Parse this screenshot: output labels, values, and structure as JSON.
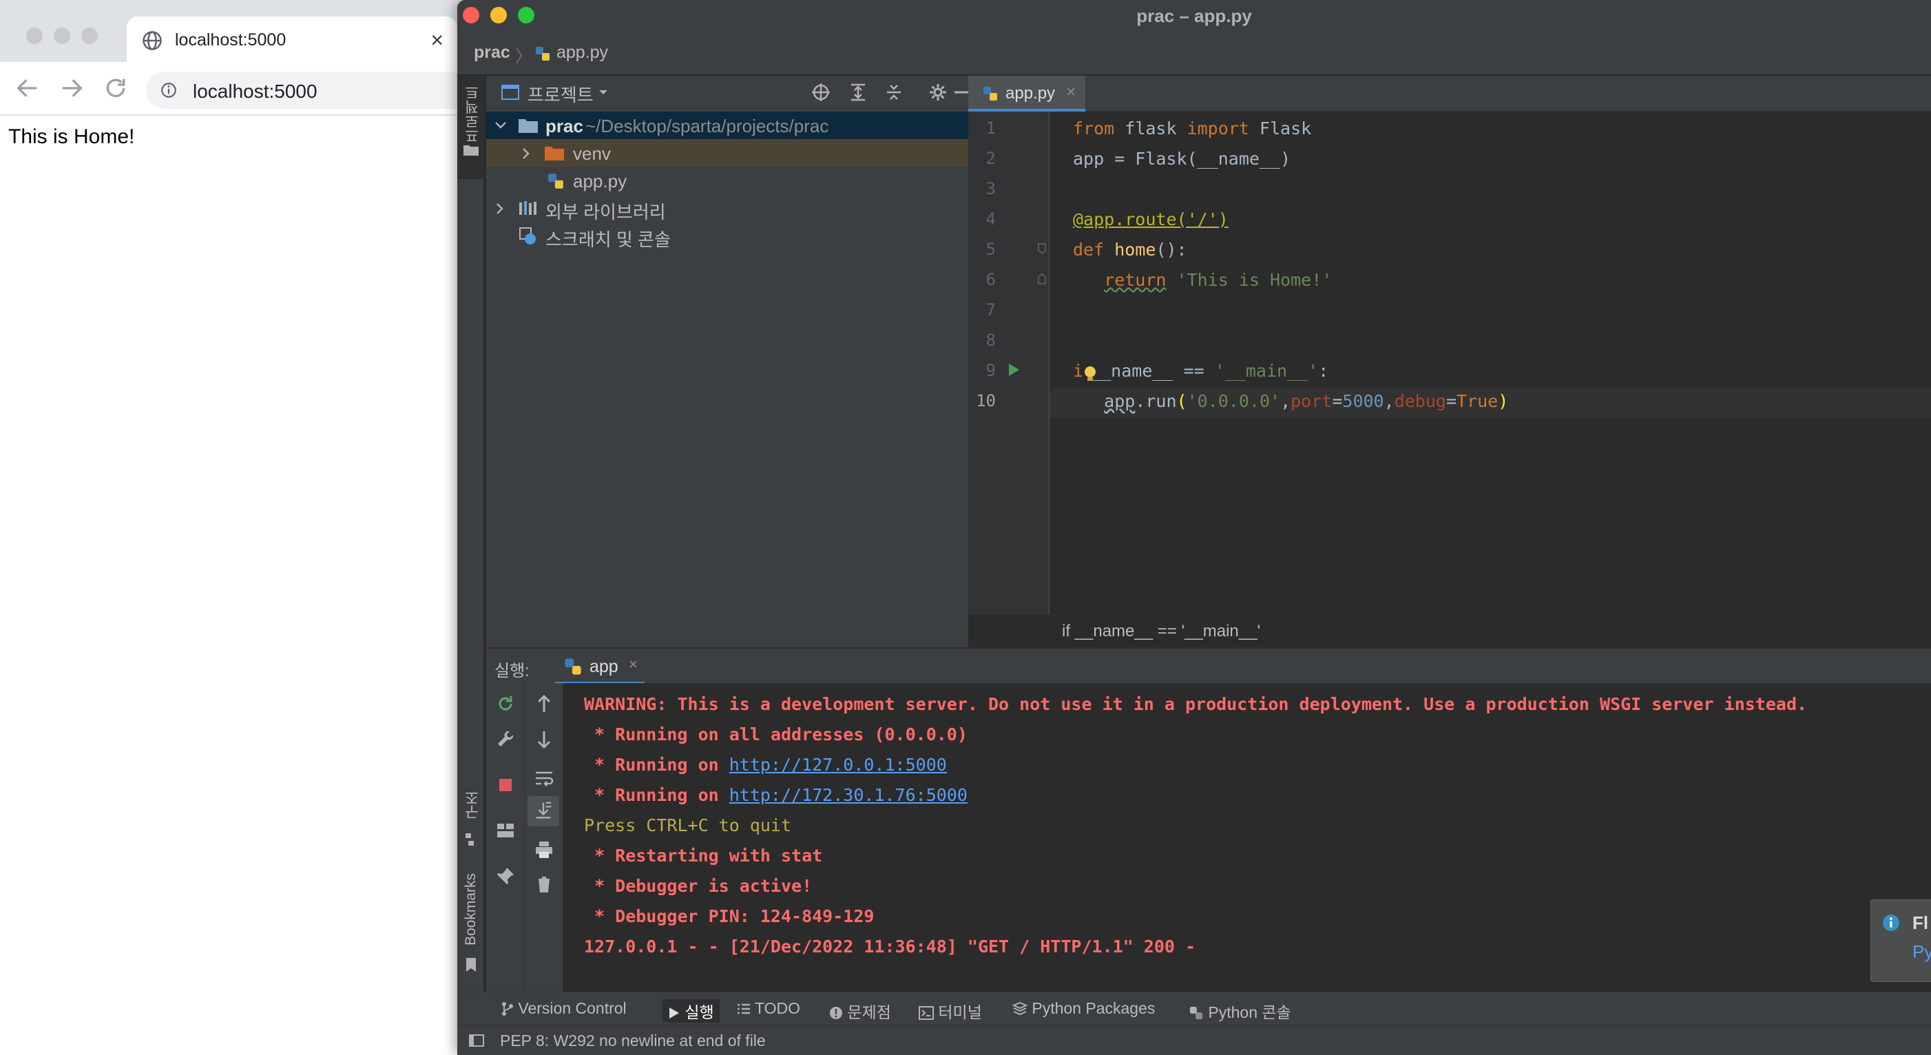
{
  "browser": {
    "tab_title": "localhost:5000",
    "close_glyph": "×",
    "url": "localhost:5000",
    "page_text": "This is Home!"
  },
  "ide": {
    "window_title": "prac – app.py",
    "nav_breadcrumb": [
      "prac",
      "app.py"
    ],
    "left_strip": {
      "project": "프로젝트",
      "structure": "구조",
      "bookmarks": "Bookmarks"
    },
    "project_panel": {
      "title": "프로젝트",
      "tree": [
        {
          "label": "prac",
          "path": "~/Desktop/sparta/projects/prac",
          "type": "folder",
          "expanded": true
        },
        {
          "label": "venv",
          "type": "folder",
          "expanded": false
        },
        {
          "label": "app.py",
          "type": "python-file"
        },
        {
          "label": "외부 라이브러리",
          "type": "library",
          "expanded": false
        },
        {
          "label": "스크래치 및 콘솔",
          "type": "scratch"
        }
      ]
    },
    "editor": {
      "tab_label": "app.py",
      "line_numbers": [
        "1",
        "2",
        "3",
        "4",
        "5",
        "6",
        "7",
        "8",
        "9",
        "10"
      ],
      "current_line": 10,
      "code_lines": [
        "from flask import Flask",
        "app = Flask(__name__)",
        "",
        "@app.route('/')",
        "def home():",
        "   return 'This is Home!'",
        "",
        "",
        "if __name__ == '__main__':",
        "   app.run('0.0.0.0',port=5000,debug=True)"
      ],
      "breadcrumb": "if __name__ == '__main__'"
    },
    "run_panel": {
      "title": "실행:",
      "tab_label": "app",
      "console_lines": [
        {
          "text": "WARNING: This is a development server. Do not use it in a production deployment. Use a production WSGI server instead.",
          "style": "red"
        },
        {
          "text": " * Running on all addresses (0.0.0.0)",
          "style": "red"
        },
        {
          "prefix": " * Running on ",
          "link": "http://127.0.0.1:5000",
          "style": "red"
        },
        {
          "prefix": " * Running on ",
          "link": "http://172.30.1.76:5000",
          "style": "red"
        },
        {
          "text": "Press CTRL+C to quit",
          "style": "yellow"
        },
        {
          "text": " * Restarting with stat",
          "style": "red"
        },
        {
          "text": " * Debugger is active!",
          "style": "red"
        },
        {
          "text": " * Debugger PIN: 124-849-129",
          "style": "red"
        },
        {
          "text": "127.0.0.1 - - [21/Dec/2022 11:36:48] \"GET / HTTP/1.1\" 200 -",
          "style": "red"
        }
      ]
    },
    "notification": {
      "title": "Fl",
      "link": "Py"
    },
    "tool_tabs": [
      "Version Control",
      "실행",
      "TODO",
      "문제점",
      "터미널",
      "Python Packages",
      "Python 콘솔"
    ],
    "active_tool_tab": "실행",
    "status_text": "PEP 8: W292 no newline at end of file",
    "colors": {
      "ide_bg": "#2b2b2b",
      "panel_bg": "#3c3f41",
      "console_red": "#ff6b68",
      "link_blue": "#589df6",
      "keyword_orange": "#cc7832"
    }
  }
}
